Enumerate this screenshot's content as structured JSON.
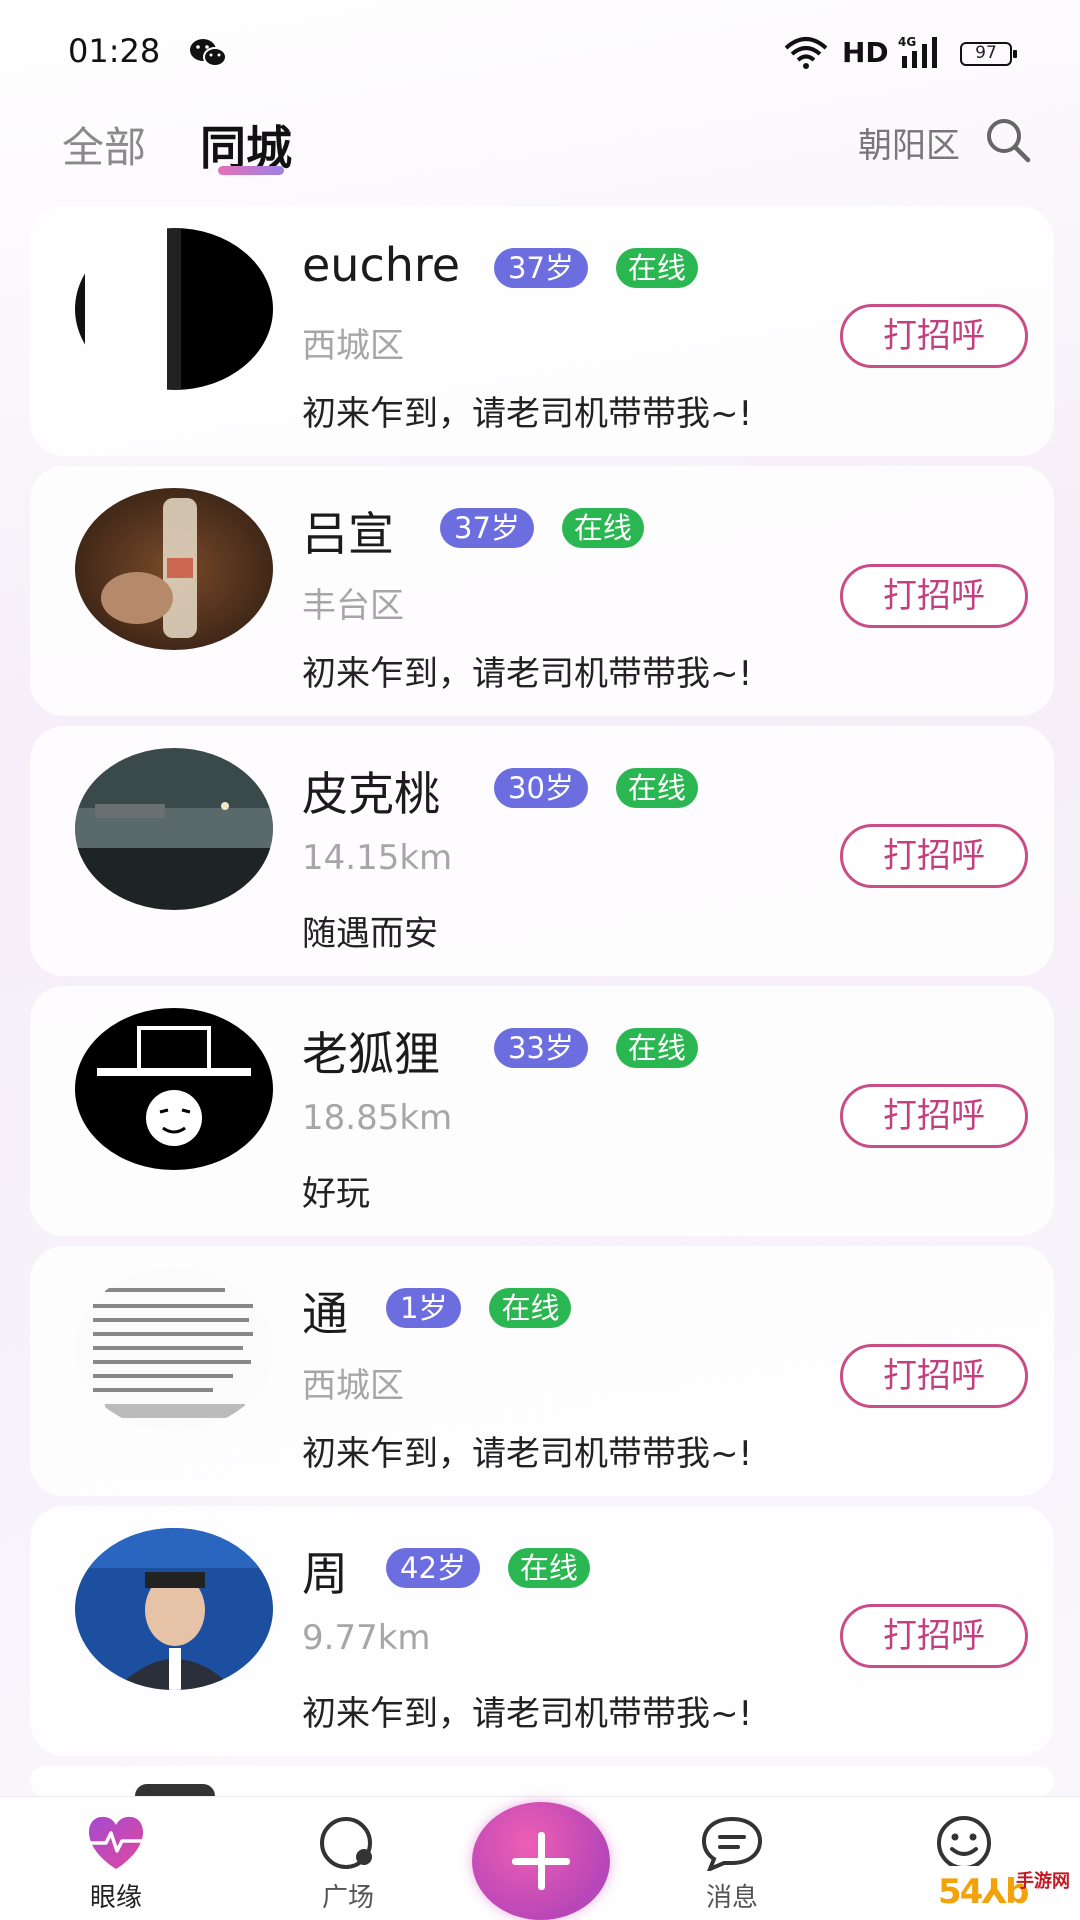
{
  "status_bar": {
    "time": "01:28",
    "network": "HD",
    "signal": "4G",
    "battery": "97",
    "icons": [
      "wechat-icon",
      "wifi-icon",
      "signal-icon",
      "battery-icon"
    ]
  },
  "header": {
    "tabs": [
      {
        "label": "全部",
        "active": false
      },
      {
        "label": "同城",
        "active": true
      }
    ],
    "location": "朝阳区",
    "search_icon": "search-icon"
  },
  "users": [
    {
      "name": "euchre",
      "age": "37岁",
      "status": "在线",
      "location": "西城区",
      "bio": "初来乍到，请老司机带带我~!",
      "button": "打招呼"
    },
    {
      "name": "吕宣",
      "age": "37岁",
      "status": "在线",
      "location": "丰台区",
      "bio": "初来乍到，请老司机带带我~!",
      "button": "打招呼"
    },
    {
      "name": "皮克桃",
      "age": "30岁",
      "status": "在线",
      "location": "14.15km",
      "bio": "随遇而安",
      "button": "打招呼"
    },
    {
      "name": "老狐狸",
      "age": "33岁",
      "status": "在线",
      "location": "18.85km",
      "bio": "好玩",
      "button": "打招呼"
    },
    {
      "name": "通",
      "age": "1岁",
      "status": "在线",
      "location": "西城区",
      "bio": "初来乍到，请老司机带带我~!",
      "button": "打招呼"
    },
    {
      "name": "周",
      "age": "42岁",
      "status": "在线",
      "location": "9.77km",
      "bio": "初来乍到，请老司机带带我~!",
      "button": "打招呼"
    }
  ],
  "bottom_nav": {
    "items": [
      {
        "label": "眼缘",
        "icon": "heart-pulse-icon",
        "active": true
      },
      {
        "label": "广场",
        "icon": "plaza-icon",
        "active": false
      },
      {
        "label": "",
        "icon": "plus-icon",
        "active": false
      },
      {
        "label": "消息",
        "icon": "message-icon",
        "active": false
      },
      {
        "label": "",
        "icon": "smiley-icon",
        "active": false
      }
    ]
  },
  "watermark": {
    "text": "54⅄b",
    "sub": "手游网"
  },
  "colors": {
    "accent_pink": "#c94d87",
    "age_badge": "#6c6ee0",
    "online_badge": "#2ab752"
  }
}
